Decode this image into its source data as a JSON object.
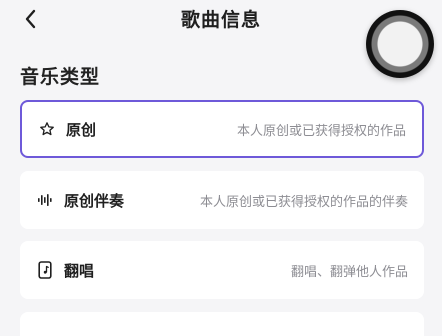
{
  "header": {
    "title": "歌曲信息",
    "back_icon": "chevron-left-icon"
  },
  "section": {
    "title": "音乐类型"
  },
  "options": [
    {
      "name": "原创",
      "description": "本人原创或已获得授权的作品",
      "icon": "star-outline-icon",
      "selected": true
    },
    {
      "name": "原创伴奏",
      "description": "本人原创或已获得授权的作品的伴奏",
      "icon": "waveform-icon",
      "selected": false
    },
    {
      "name": "翻唱",
      "description": "翻唱、翻弹他人作品",
      "icon": "phone-music-icon",
      "selected": false
    }
  ],
  "colors": {
    "accent": "#6e59d9",
    "background": "#f5f5f7",
    "card": "#ffffff",
    "secondary_text": "#8d8d93"
  }
}
